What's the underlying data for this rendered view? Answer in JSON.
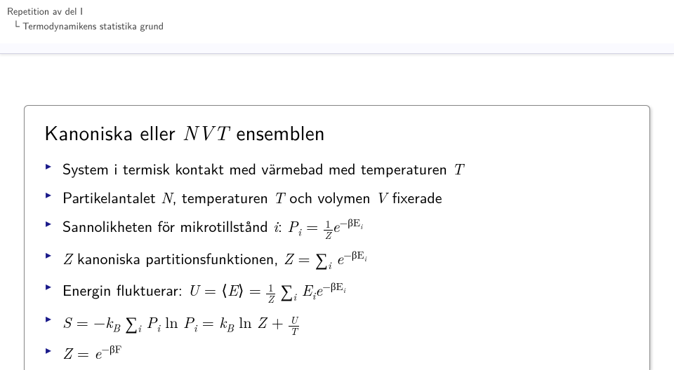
{
  "breadcrumb": {
    "line1": "Repetition av del I",
    "line2": "Termodynamikens statistika grund"
  },
  "slide": {
    "title_pre": "Kanoniska eller ",
    "title_nvt": "NVT",
    "title_post": " ensemblen",
    "items": {
      "i0_pre": "System i termisk kontakt med värmebad med temperaturen ",
      "i0_T": "T",
      "i1_pre": "Partikelantalet ",
      "i1_N": "N",
      "i1_mid": ", temperaturen ",
      "i1_T": "T",
      "i1_mid2": " och volymen ",
      "i1_V": "V",
      "i1_post": " fixerade",
      "i2_pre": "Sannolikheten för mikrotillstånd ",
      "i2_i": "i",
      "i2_sep": ": ",
      "i2_Pi": "P",
      "i2_Pi_sub": "i",
      "i2_eq": " = ",
      "i2_frac_num": "1",
      "i2_frac_den": "Z",
      "i2_e": "e",
      "i2_exp": "−βE",
      "i2_exp_sub": "i",
      "i3_Z": "Z",
      "i3_mid": " kanoniska partitionsfunktionen, ",
      "i3_Z2": "Z",
      "i3_eq": " = ",
      "i3_e": "e",
      "i3_exp": "−βE",
      "i3_exp_sub": "i",
      "i3_sum_sub": "i",
      "i4_pre": "Energin fluktuerar: ",
      "i4_U": "U",
      "i4_eq1": " = ",
      "i4_lang": "⟨",
      "i4_E": "E",
      "i4_rang": "⟩",
      "i4_eq2": " = ",
      "i4_frac_num": "1",
      "i4_frac_den": "Z",
      "i4_sum_sub": "i",
      "i4_Ei": "E",
      "i4_Ei_sub": "i",
      "i4_e": "e",
      "i4_exp": "−βE",
      "i4_exp_sub": "i",
      "i5_S": "S",
      "i5_eq": " = −",
      "i5_k": "k",
      "i5_B": "B",
      "i5_sum_sub": "i",
      "i5_P1": "P",
      "i5_P1_sub": "i",
      "i5_ln": " ln ",
      "i5_P2": "P",
      "i5_P2_sub": "i",
      "i5_mid": " = ",
      "i5_k2": "k",
      "i5_B2": "B",
      "i5_ln2": " ln ",
      "i5_Z": "Z",
      "i5_plus": " + ",
      "i5_frac_num": "U",
      "i5_frac_den": "T",
      "i6_Z": "Z",
      "i6_eq": " = ",
      "i6_e": "e",
      "i6_exp": "−βF"
    }
  }
}
